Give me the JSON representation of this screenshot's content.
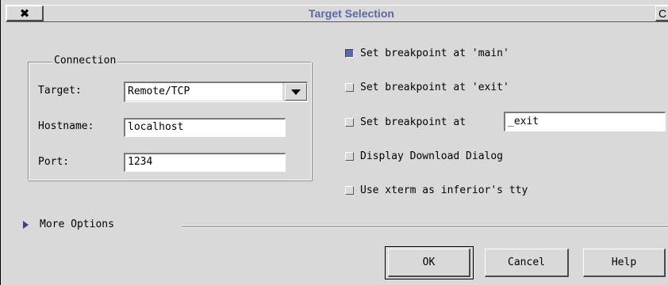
{
  "window": {
    "title": "Target Selection",
    "close_glyph": "✖",
    "right_button_glyph": "C"
  },
  "connection": {
    "group_title": "Connection",
    "target_label": "Target:",
    "target_value": "Remote/TCP",
    "hostname_label": "Hostname:",
    "hostname_value": "localhost",
    "port_label": "Port:",
    "port_value": "1234"
  },
  "options": {
    "bp_main": {
      "label": "Set breakpoint at 'main'",
      "checked": true
    },
    "bp_exit": {
      "label": "Set breakpoint at 'exit'",
      "checked": false
    },
    "bp_at": {
      "label": "Set breakpoint at",
      "checked": false,
      "value": "_exit"
    },
    "download_dialog": {
      "label": "Display Download Dialog",
      "checked": false
    },
    "xterm": {
      "label": "Use xterm as inferior's tty",
      "checked": false
    }
  },
  "more_options": {
    "label": "More Options"
  },
  "buttons": {
    "ok": "OK",
    "cancel": "Cancel",
    "help": "Help"
  },
  "colors": {
    "accent": "#5a67a8",
    "background": "#d9d9d9"
  }
}
